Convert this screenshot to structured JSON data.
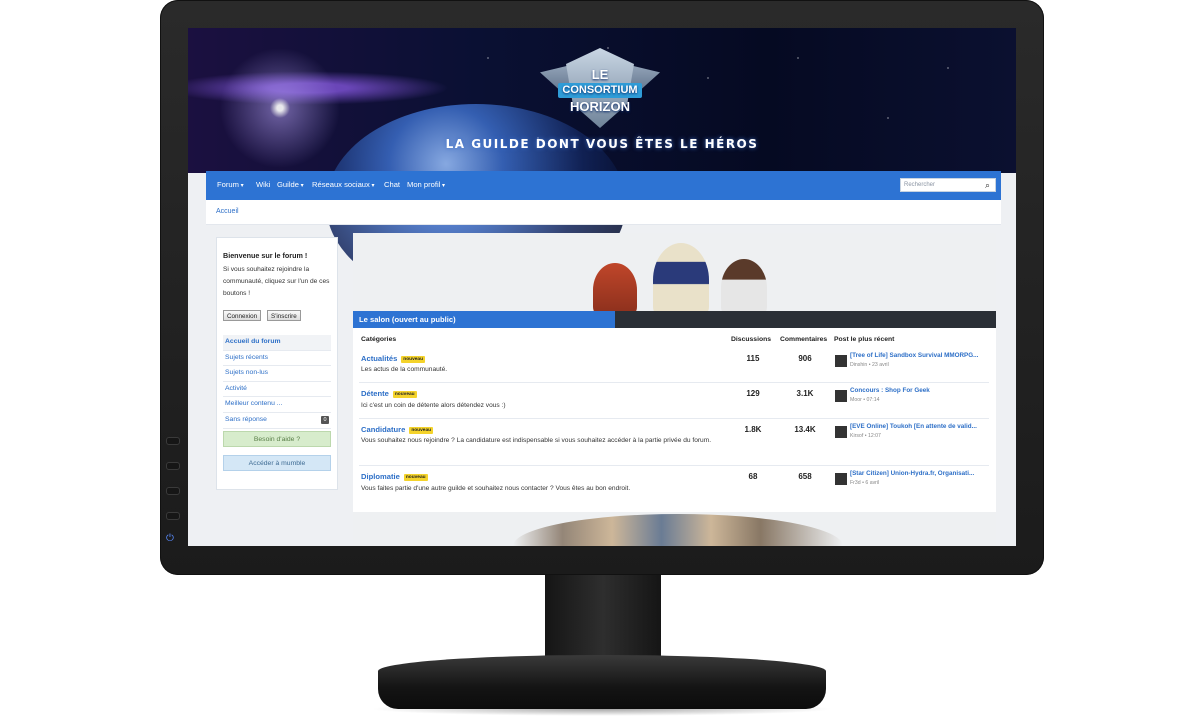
{
  "banner": {
    "logo_top": "LE",
    "logo_middle": "CONSORTIUM",
    "logo_bottom": "HORIZON",
    "tagline": "LA GUILDE DONT VOUS ÊTES LE HÉROS"
  },
  "nav": {
    "items": [
      "Forum",
      "Wiki",
      "Guilde",
      "Réseaux sociaux",
      "Chat",
      "Mon profil"
    ],
    "search_placeholder": "Rechercher"
  },
  "breadcrumb": "Accueil",
  "sidebar": {
    "title": "Bienvenue sur le forum !",
    "description": "Si vous souhaitez rejoindre la communauté, cliquez sur l'un de ces boutons !",
    "login": "Connexion",
    "register": "S'inscrire",
    "menu": [
      {
        "label": "Accueil du forum"
      },
      {
        "label": "Sujets récents"
      },
      {
        "label": "Sujets non-lus"
      },
      {
        "label": "Activité"
      },
      {
        "label": "Meilleur contenu ..."
      },
      {
        "label": "Sans réponse",
        "count": "0"
      }
    ],
    "help": "Besoin d'aide ?",
    "mumble": "Accéder à mumble"
  },
  "section": {
    "title": "Le salon (ouvert au public)",
    "headers": {
      "categories": "Catégories",
      "discussions": "Discussions",
      "comments": "Commentaires",
      "recent": "Post le plus récent"
    },
    "new_badge": "nouveau",
    "rows": [
      {
        "name": "Actualités",
        "desc": "Les actus de la communauté.",
        "discussions": "115",
        "comments": "906",
        "recent_title": "[Tree of Life] Sandbox Survival MMORPG...",
        "recent_meta": "Dinshin • 23 avril"
      },
      {
        "name": "Détente",
        "desc": "Ici c'est un coin de détente alors détendez vous :)",
        "discussions": "129",
        "comments": "3.1K",
        "recent_title": "Concours : Shop For Geek",
        "recent_meta": "Moor • 07:14"
      },
      {
        "name": "Candidature",
        "desc": "Vous souhaitez nous rejoindre ? La candidature est indispensable si vous souhaitez accéder à la partie privée du forum.",
        "discussions": "1.8K",
        "comments": "13.4K",
        "recent_title": "[EVE Online] Toukoh [En attente de valid...",
        "recent_meta": "Kirsof • 12:07"
      },
      {
        "name": "Diplomatie",
        "desc": "Vous faites partie d'une autre guilde et souhaitez nous contacter ? Vous êtes au bon endroit.",
        "discussions": "68",
        "comments": "658",
        "recent_title": "[Star Citizen] Union-Hydra.fr, Organisati...",
        "recent_meta": "Fr3d • 6 avril"
      }
    ]
  }
}
